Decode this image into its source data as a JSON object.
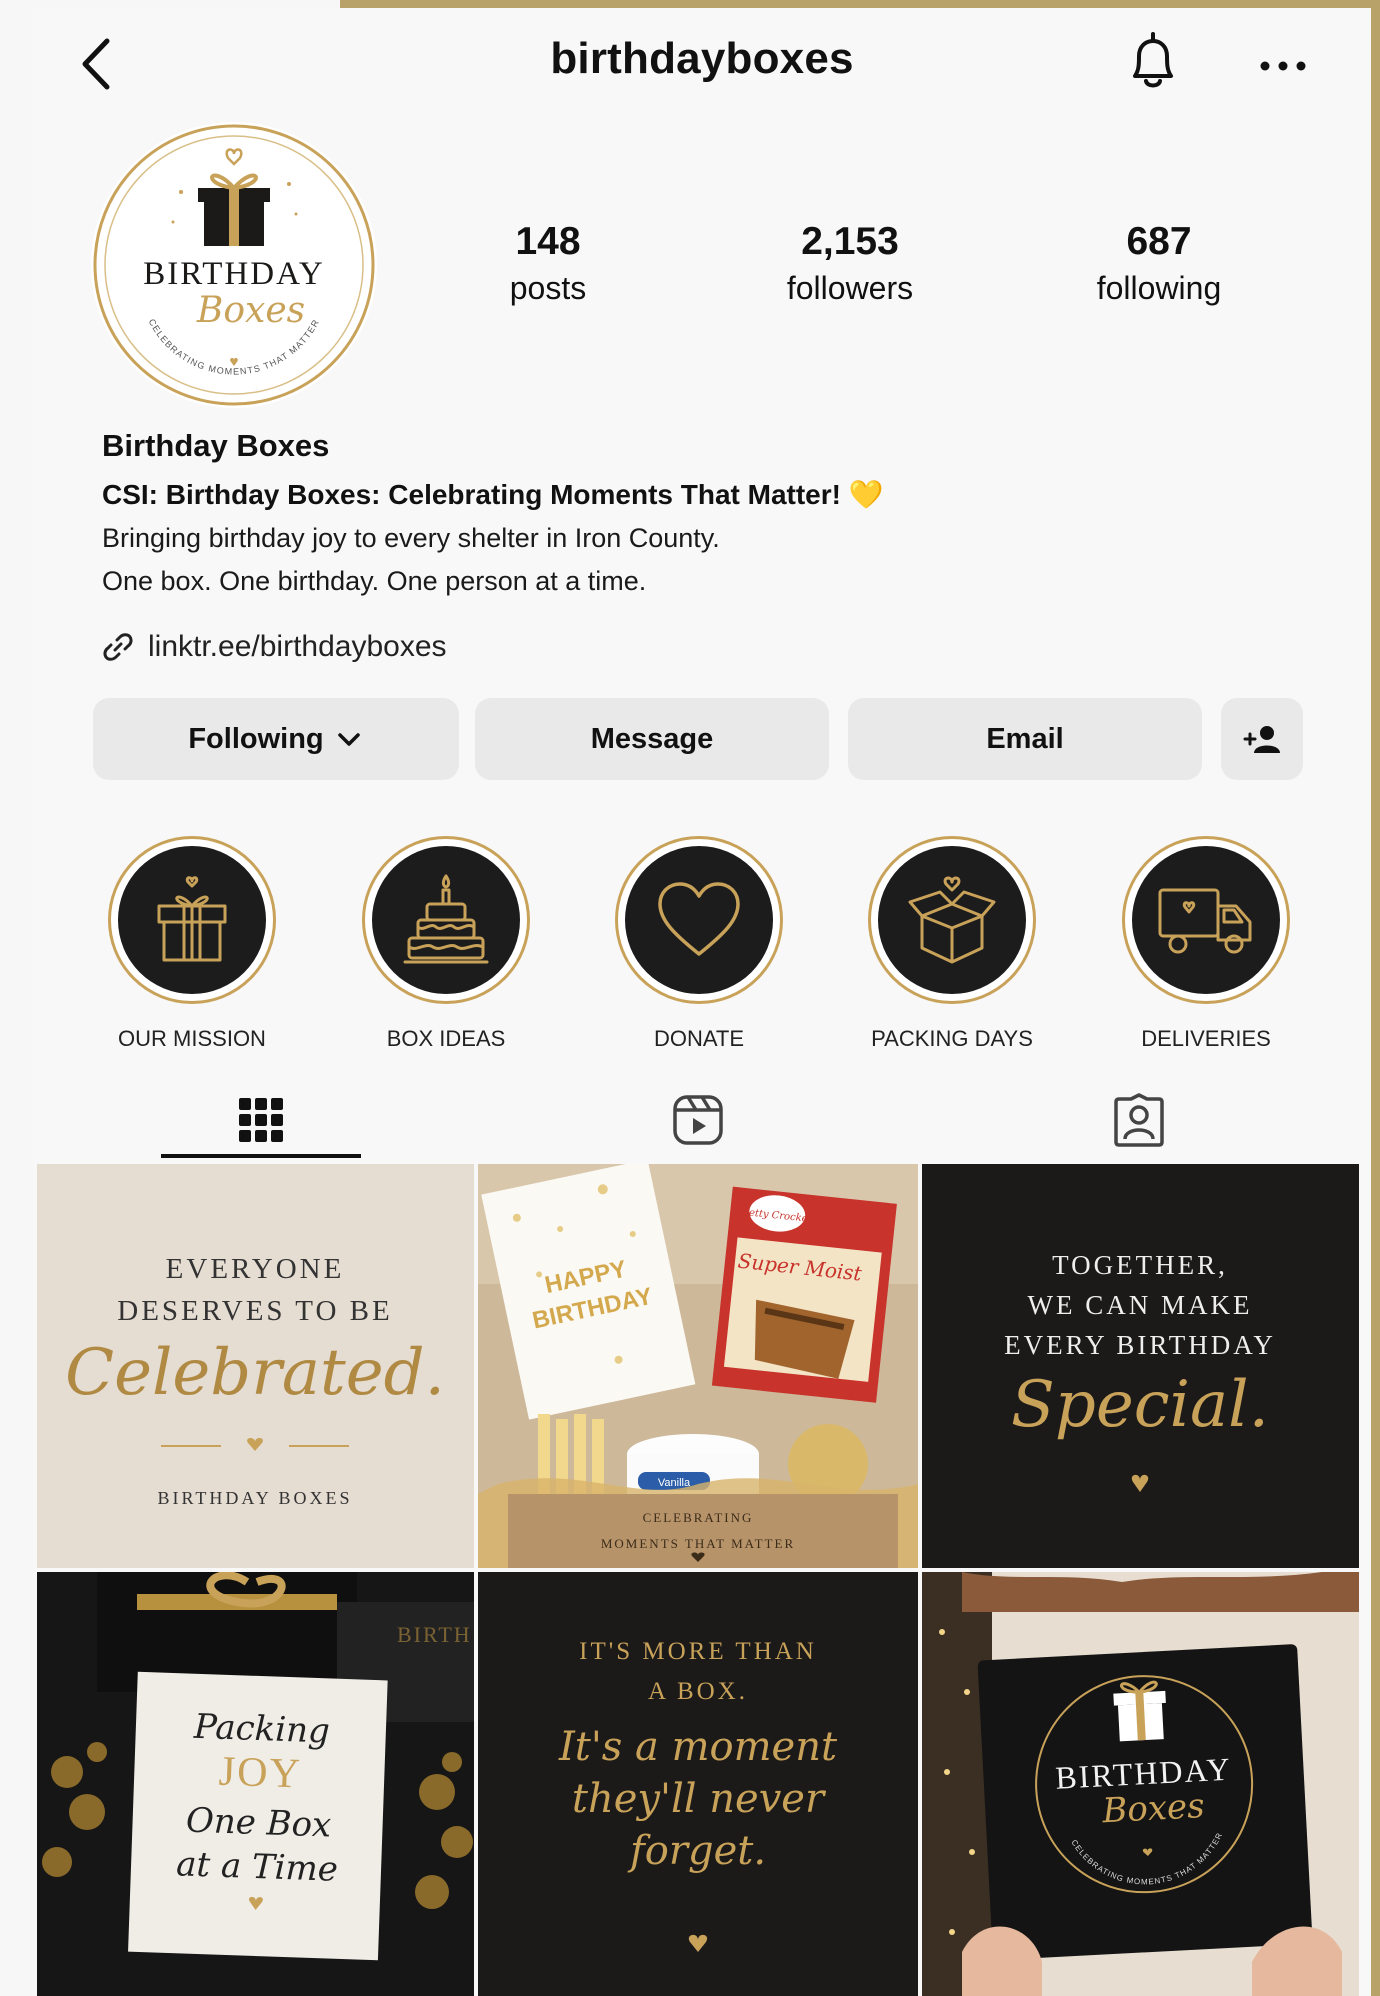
{
  "header": {
    "username": "birthdayboxes"
  },
  "profile": {
    "avatar": {
      "title": "BIRTHDAY",
      "script": "Boxes",
      "tagline": "CELEBRATING MOMENTS THAT MATTER"
    },
    "stats": [
      {
        "value": "148",
        "label": "posts"
      },
      {
        "value": "2,153",
        "label": "followers"
      },
      {
        "value": "687",
        "label": "following"
      }
    ],
    "name": "Birthday Boxes",
    "category": "CSI: Birthday Boxes: Celebrating Moments That Matter! 💛",
    "bio_lines": [
      "Bringing birthday joy to every shelter in Iron County.",
      "One box. One birthday. One person at a time."
    ],
    "link": "linktr.ee/birthdayboxes"
  },
  "actions": {
    "following": "Following",
    "message": "Message",
    "email": "Email"
  },
  "highlights": [
    {
      "label": "OUR MISSION",
      "icon": "gift-icon"
    },
    {
      "label": "BOX IDEAS",
      "icon": "cake-icon"
    },
    {
      "label": "DONATE",
      "icon": "heart-icon"
    },
    {
      "label": "PACKING DAYS",
      "icon": "open-box-icon"
    },
    {
      "label": "DELIVERIES",
      "icon": "truck-icon"
    }
  ],
  "tabs": [
    "grid-icon",
    "reels-icon",
    "tagged-icon"
  ],
  "posts": [
    {
      "lines": [
        "EVERYONE",
        "DESERVES TO BE"
      ],
      "script": "Celebrated.",
      "footer": "BIRTHDAY BOXES"
    },
    {
      "card": [
        "HAPPY",
        "BIRTHDAY"
      ],
      "mix": [
        "Betty Crocker",
        "Super Moist"
      ],
      "tub": "Vanilla",
      "box_lines": [
        "CELEBRATING",
        "MOMENTS THAT MATTER"
      ]
    },
    {
      "lines": [
        "TOGETHER,",
        "WE CAN MAKE",
        "EVERY BIRTHDAY"
      ],
      "script": "Special."
    },
    {
      "script_lines": [
        "Packing",
        "JOY",
        "One Box",
        "at a Time"
      ],
      "box_text": "BIRTH"
    },
    {
      "lines": [
        "IT'S MORE THAN",
        "A BOX."
      ],
      "script_lines": [
        "It's a moment",
        "they'll never",
        "forget."
      ]
    },
    {
      "title": "BIRTHDAY",
      "script": "Boxes",
      "tagline": "CELEBRATING MOMENTS THAT MATTER"
    }
  ],
  "colors": {
    "gold": "#c9a25a",
    "dark": "#1b1a19",
    "beige": "#e5dcd2"
  }
}
